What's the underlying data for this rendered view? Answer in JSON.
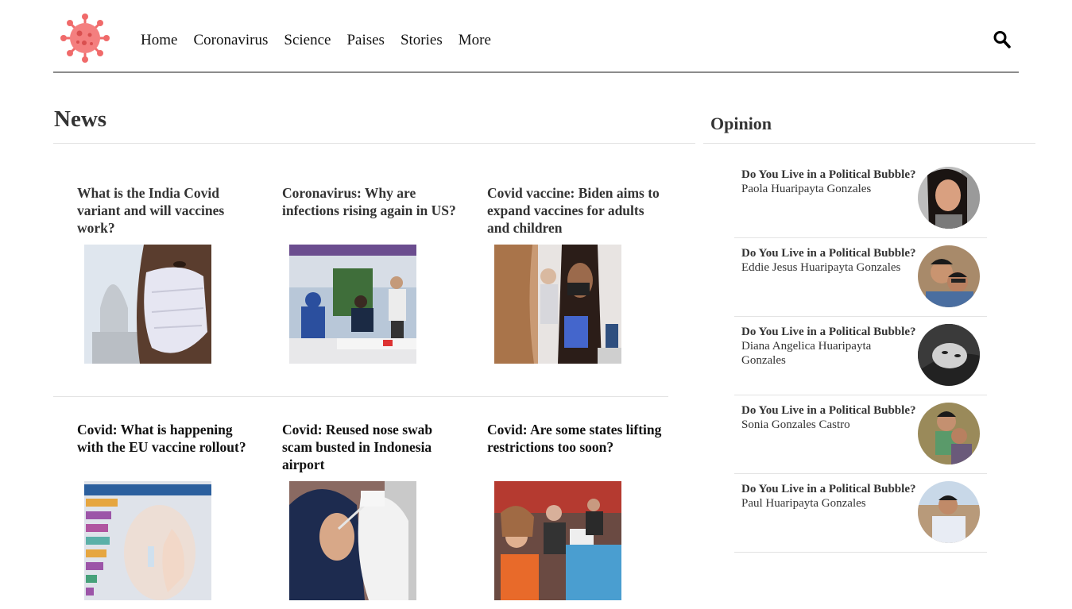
{
  "header": {
    "logo_icon": "coronavirus-icon",
    "nav": [
      "Home",
      "Coronavirus",
      "Science",
      "Paises",
      "Stories",
      "More"
    ],
    "search_icon": "search-icon"
  },
  "news": {
    "title": "News",
    "articles": [
      {
        "title": "What is the India Covid variant and will vaccines work?",
        "image": "mask-woman-photo"
      },
      {
        "title": "Coronavirus: Why are infections rising again in US?",
        "image": "testing-site-photo"
      },
      {
        "title": "Covid vaccine: Biden aims to expand vaccines for adults and children",
        "image": "vaccination-photo"
      },
      {
        "title": "Covid: What is happening with the EU vaccine rollout?",
        "image": "vaccine-chart-photo"
      },
      {
        "title": "Covid: Reused nose swab scam busted in Indonesia airport",
        "image": "nose-swab-photo"
      },
      {
        "title": "Covid: Are some states lifting restrictions too soon?",
        "image": "crowd-table-photo"
      }
    ]
  },
  "opinion": {
    "title": "Opinion",
    "items": [
      {
        "title": "Do You Live in a Political Bubble?",
        "author": "Paola Huaripayta Gonzales"
      },
      {
        "title": "Do You Live in a Political Bubble?",
        "author": "Eddie Jesus Huaripayta Gonzales"
      },
      {
        "title": "Do You Live in a Political Bubble?",
        "author": "Diana Angelica Huaripayta Gonzales"
      },
      {
        "title": "Do You Live in a Political Bubble?",
        "author": "Sonia Gonzales Castro"
      },
      {
        "title": "Do You Live in a Political Bubble?",
        "author": "Paul Huaripayta Gonzales"
      }
    ]
  },
  "colors": {
    "logo": "#f06a6a",
    "text": "#333333",
    "rule": "#8c8c8c"
  }
}
